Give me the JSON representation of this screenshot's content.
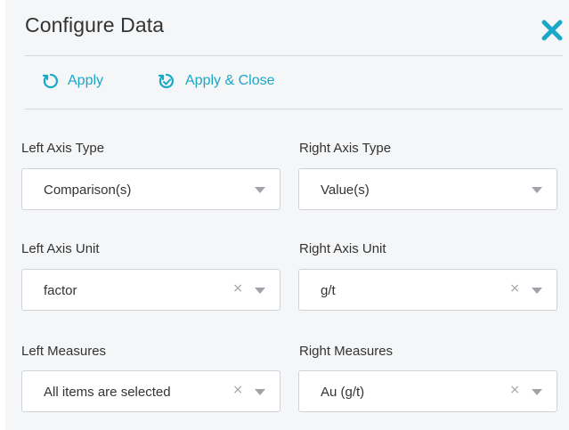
{
  "dialog": {
    "title": "Configure Data",
    "close_icon": "close-icon",
    "accent_color": "#1aa8c8"
  },
  "toolbar": {
    "apply_label": "Apply",
    "apply_close_label": "Apply & Close",
    "apply_icon": "refresh-icon",
    "apply_close_icon": "refresh-check-icon"
  },
  "fields": {
    "left_axis_type": {
      "label": "Left Axis Type",
      "value": "Comparison(s)"
    },
    "right_axis_type": {
      "label": "Right Axis Type",
      "value": "Value(s)"
    },
    "left_axis_unit": {
      "label": "Left Axis Unit",
      "value": "factor",
      "clear": "×"
    },
    "right_axis_unit": {
      "label": "Right Axis Unit",
      "value": "g/t",
      "clear": "×"
    },
    "left_measures": {
      "label": "Left Measures",
      "value": "All items are selected",
      "clear": "×"
    },
    "right_measures": {
      "label": "Right Measures",
      "value": "Au (g/t)",
      "clear": "×"
    }
  }
}
